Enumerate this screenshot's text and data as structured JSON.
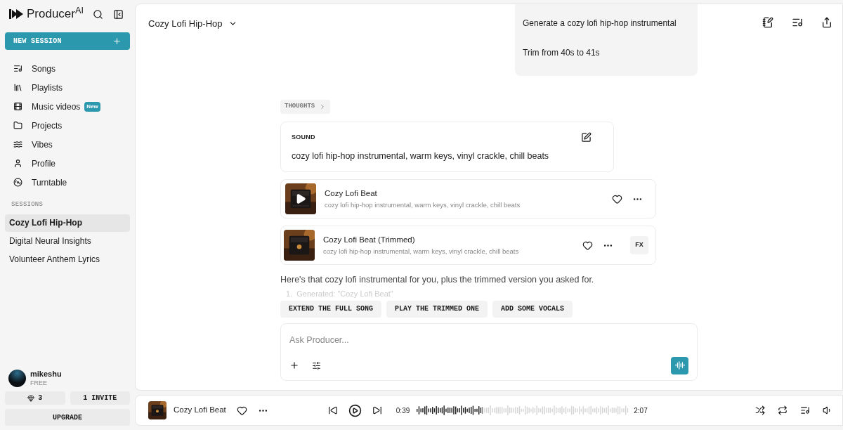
{
  "sidebar": {
    "logo": "Producer$^{AI}$",
    "new_session": "NEW SESSION",
    "nav": [
      {
        "label": "Songs"
      },
      {
        "label": "Playlists"
      },
      {
        "label": "Music videos",
        "badge": "New"
      },
      {
        "label": "Projects"
      },
      {
        "label": "Vibes"
      },
      {
        "label": "Profile"
      },
      {
        "label": "Turntable"
      }
    ],
    "sessions_heading": "SESSIONS",
    "sessions": [
      {
        "label": "Cozy Lofi Hip-Hop",
        "selected": true
      },
      {
        "label": "Digital Neural Insights",
        "selected": false
      },
      {
        "label": "Volunteer Anthem Lyrics",
        "selected": false
      }
    ],
    "user": {
      "name": "mikeshu",
      "plan": "FREE"
    },
    "credits": "3",
    "invite": "1 INVITE",
    "upgrade": "UPGRADE"
  },
  "header": {
    "title": "Cozy Lofi Hip-Hop"
  },
  "chat": {
    "user_messages": [
      "Generate a cozy lofi hip-hop instrumental",
      "Trim from 40s to 41s"
    ],
    "thoughts": "THOUGHTS",
    "sound": {
      "label": "SOUND",
      "text": "cozy lofi hip-hop instrumental, warm keys, vinyl crackle, chill beats"
    },
    "tracks": [
      {
        "title": "Cozy Lofi Beat",
        "description": "cozy lofi hip-hop instrumental, warm keys, vinyl crackle, chill beats",
        "show_play": true
      },
      {
        "title": "Cozy Lofi Beat (Trimmed)",
        "description": "cozy lofi hip-hop instrumental, warm keys, vinyl crackle, chill beats",
        "show_play": false,
        "fx": "FX"
      }
    ],
    "reply": "Here's that cozy lofi instrumental for you, plus the trimmed version you asked for.",
    "list_item": "1.  Generated: \"Cozy Lofi Beat\"",
    "suggestions": [
      "EXTEND THE FULL SONG",
      "PLAY THE TRIMMED ONE",
      "ADD SOME VOCALS"
    ],
    "input": {
      "placeholder": "Ask Producer..."
    }
  },
  "player": {
    "title": "Cozy Lofi Beat",
    "elapsed": "0:39",
    "duration": "2:07",
    "level": 0.31
  }
}
